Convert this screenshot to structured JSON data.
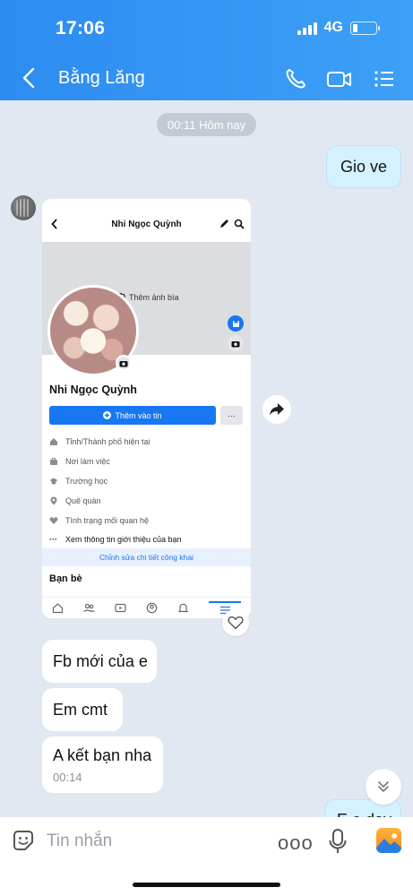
{
  "status": {
    "time": "17:06",
    "network": "4G",
    "battery_level": 0.2
  },
  "header": {
    "title": "Bằng Lăng"
  },
  "chat": {
    "date_pill": "00:11 Hôm nay",
    "out_messages": [
      {
        "text": "Gio ve"
      },
      {
        "text": "E o day"
      }
    ],
    "shared_image": {
      "bar_title": "Nhi Ngọc Quỳnh",
      "cover_label": "Thêm ảnh bìa",
      "profile_name": "Nhi Ngọc Quỳnh",
      "add_story": "Thêm vào tin",
      "more": "···",
      "info": [
        "Tỉnh/Thành phố hiện tại",
        "Nơi làm việc",
        "Trường học",
        "Quê quán",
        "Tình trạng mối quan hệ",
        "Xem thông tin giới thiệu của bạn"
      ],
      "edit_public": "Chỉnh sửa chi tiết công khai",
      "friends": "Bạn bè"
    },
    "in_messages": [
      {
        "text": "Fb mới của e"
      },
      {
        "text": "Em cmt"
      },
      {
        "text": "A kết bạn nha",
        "time": "00:14"
      }
    ]
  },
  "input": {
    "placeholder": "Tin nhắn",
    "more": "ooo"
  },
  "colors": {
    "header": "#2c8cf0",
    "out_bubble": "#d5f1ff",
    "chat_bg": "#e2e8f1",
    "fb_blue": "#1877f2"
  }
}
